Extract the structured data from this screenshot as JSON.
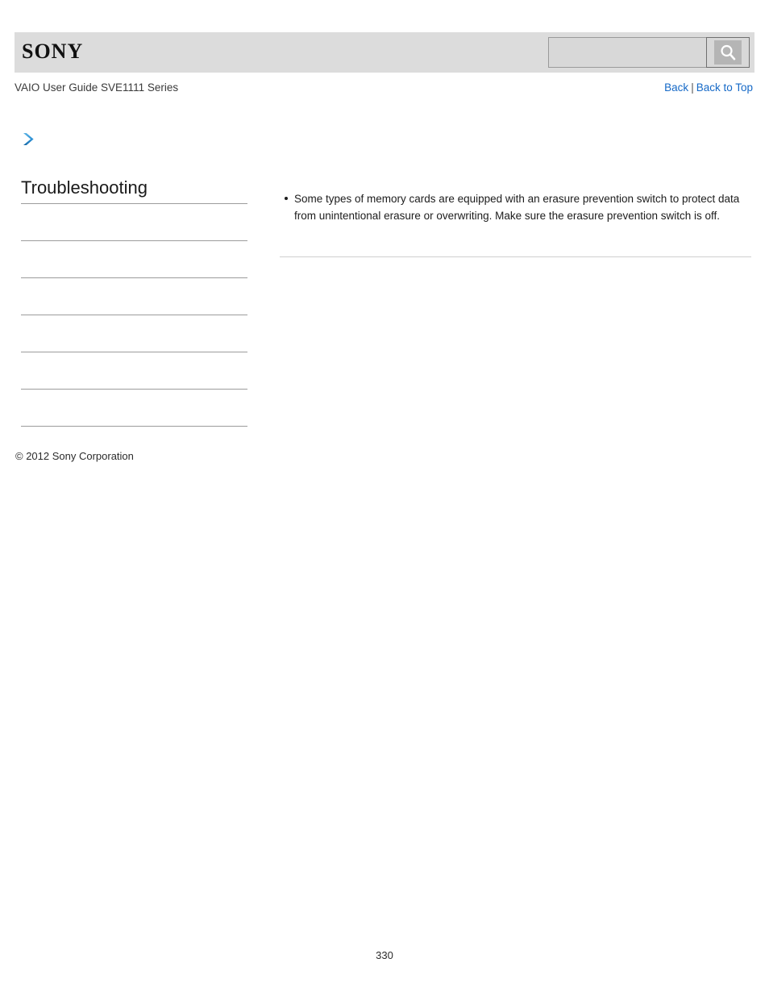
{
  "header": {
    "logo_text": "SONY",
    "logo_icon": "sony-wordmark",
    "search": {
      "value": "",
      "placeholder": "",
      "button_icon": "search-icon"
    }
  },
  "subheader": {
    "guide_title": "VAIO User Guide SVE1111 Series",
    "links": {
      "back": "Back",
      "separator": "|",
      "back_to_top": "Back to Top"
    }
  },
  "sidebar": {
    "chevron_icon": "chevron-right-icon",
    "heading": "Troubleshooting",
    "divider_count": 7,
    "items": []
  },
  "content": {
    "bullets": [
      "Some types of memory cards are equipped with an erasure prevention switch to protect data from unintentional erasure or overwriting. Make sure the erasure prevention switch is off."
    ]
  },
  "footer": {
    "copyright": "© 2012 Sony Corporation",
    "page_number": "330"
  },
  "colors": {
    "header_bg": "#dcdcdc",
    "link_blue": "#1569c7",
    "chevron_blue": "#2b8fd4",
    "divider_gray": "#9c9c9c",
    "rule_gray": "#cfcfcf",
    "page_bg": "#ffffff"
  }
}
